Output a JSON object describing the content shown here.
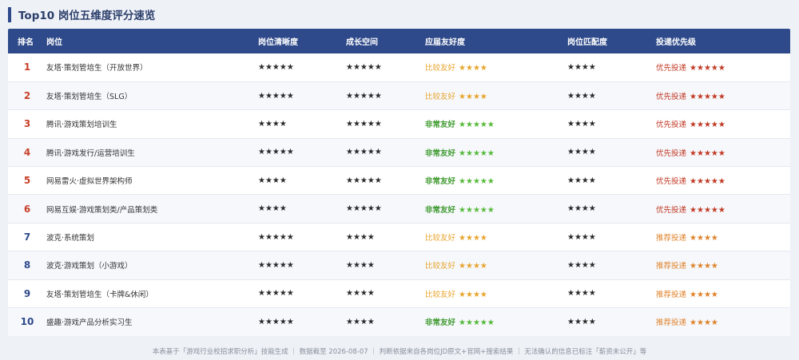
{
  "header": {
    "title": "Top10 岗位五维度评分速览"
  },
  "table": {
    "columns": [
      "排名",
      "岗位",
      "岗位清晰度",
      "成长空间",
      "应届友好度",
      "岗位匹配度",
      "投递优先级"
    ],
    "rows": [
      {
        "rank": "1",
        "name": "友塔·策划管培生（开放世界）",
        "clarity": "★★★★★",
        "growth": "★★★★★",
        "friendly_label": "比较友好",
        "friendly_stars": "★★★★",
        "match": "★★★★",
        "priority_label": "优先投递",
        "priority_stars": "★★★★★"
      },
      {
        "rank": "2",
        "name": "友塔·策划管培生（SLG）",
        "clarity": "★★★★★",
        "growth": "★★★★★",
        "friendly_label": "比较友好",
        "friendly_stars": "★★★★",
        "match": "★★★★",
        "priority_label": "优先投递",
        "priority_stars": "★★★★★"
      },
      {
        "rank": "3",
        "name": "腾讯·游戏策划培训生",
        "clarity": "★★★★",
        "growth": "★★★★★",
        "friendly_label": "非常友好",
        "friendly_stars": "★★★★★",
        "match": "★★★★",
        "priority_label": "优先投递",
        "priority_stars": "★★★★★"
      },
      {
        "rank": "4",
        "name": "腾讯·游戏发行/运营培训生",
        "clarity": "★★★★★",
        "growth": "★★★★★",
        "friendly_label": "非常友好",
        "friendly_stars": "★★★★★",
        "match": "★★★★",
        "priority_label": "优先投递",
        "priority_stars": "★★★★★"
      },
      {
        "rank": "5",
        "name": "网易雷火·虚拟世界架构师",
        "clarity": "★★★★",
        "growth": "★★★★★",
        "friendly_label": "非常友好",
        "friendly_stars": "★★★★★",
        "match": "★★★★",
        "priority_label": "优先投递",
        "priority_stars": "★★★★★"
      },
      {
        "rank": "6",
        "name": "网易互娱·游戏策划类/产品策划类",
        "clarity": "★★★★",
        "growth": "★★★★★",
        "friendly_label": "非常友好",
        "friendly_stars": "★★★★★",
        "match": "★★★★",
        "priority_label": "优先投递",
        "priority_stars": "★★★★★"
      },
      {
        "rank": "7",
        "name": "波克·系统策划",
        "clarity": "★★★★★",
        "growth": "★★★★",
        "friendly_label": "比较友好",
        "friendly_stars": "★★★★",
        "match": "★★★★",
        "priority_label": "推荐投递",
        "priority_stars": "★★★★"
      },
      {
        "rank": "8",
        "name": "波克·游戏策划（小游戏）",
        "clarity": "★★★★★",
        "growth": "★★★★",
        "friendly_label": "比较友好",
        "friendly_stars": "★★★★",
        "match": "★★★★",
        "priority_label": "推荐投递",
        "priority_stars": "★★★★"
      },
      {
        "rank": "9",
        "name": "友塔·策划管培生（卡牌&休闲）",
        "clarity": "★★★★★",
        "growth": "★★★★",
        "friendly_label": "比较友好",
        "friendly_stars": "★★★★",
        "match": "★★★★",
        "priority_label": "推荐投递",
        "priority_stars": "★★★★"
      },
      {
        "rank": "10",
        "name": "盛趣·游戏产品分析实习生",
        "clarity": "★★★★★",
        "growth": "★★★★",
        "friendly_label": "非常友好",
        "friendly_stars": "★★★★★",
        "match": "★★★★",
        "priority_label": "推荐投递",
        "priority_stars": "★★★★"
      }
    ]
  },
  "footer": {
    "text": "本表基于「游戏行业校招求职分析」技能生成 ｜ 数据截至 2026-08-07 ｜ 判断依据来自各岗位JD原文+官网+搜索结果 ｜ 无法确认的信息已标注「薪资未公开」等"
  },
  "colors": {
    "header_bg": "#2f4a8a",
    "rank_top": "#c8402a",
    "rank_rest": "#2f4a8a",
    "friendly_good": "#e8a42b",
    "friendly_great": "#3e9a2e",
    "priority_first": "#c23a25",
    "priority_recommend": "#e0822a"
  }
}
